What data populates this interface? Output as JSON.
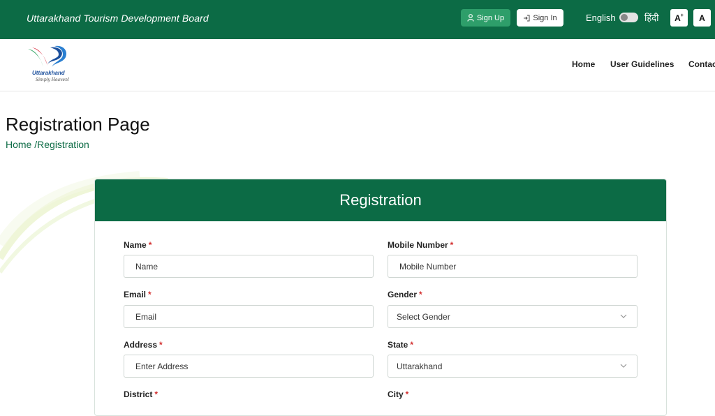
{
  "topbar": {
    "title": "Uttarakhand Tourism Development Board",
    "signup_label": "Sign Up",
    "signin_label": "Sign In",
    "lang_english": "English",
    "lang_hindi": "हिंदी",
    "font_increase": "A",
    "font_reset": "A"
  },
  "logo": {
    "name": "Uttarakhand",
    "tagline": "Simply Heaven!"
  },
  "nav": {
    "items": [
      "Home",
      "User Guidelines",
      "Contact"
    ]
  },
  "page": {
    "title": "Registration Page",
    "breadcrumb_home": "Home",
    "breadcrumb_sep": "/",
    "breadcrumb_current": "Registration"
  },
  "form": {
    "heading": "Registration",
    "required_mark": "*",
    "name_label": "Name",
    "name_placeholder": "Name",
    "mobile_label": "Mobile Number",
    "mobile_placeholder": "Mobile Number",
    "email_label": "Email",
    "email_placeholder": "Email",
    "gender_label": "Gender",
    "gender_value": "Select Gender",
    "address_label": "Address",
    "address_placeholder": "Enter Address",
    "state_label": "State",
    "state_value": "Uttarakhand",
    "district_label": "District",
    "city_label": "City"
  },
  "colors": {
    "brand_green": "#0c6b45",
    "signup_green": "#2e9e6a",
    "required_red": "#d32f2f"
  }
}
